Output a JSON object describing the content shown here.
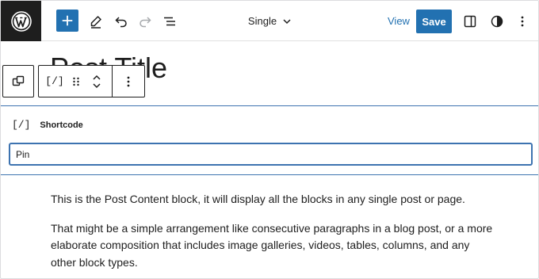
{
  "header": {
    "document_title": "Single",
    "view_label": "View",
    "save_label": "Save"
  },
  "post": {
    "title": "Post Title"
  },
  "block_toolbar": {
    "block_icon_text": "[/]"
  },
  "shortcode_block": {
    "icon_text": "[/]",
    "label": "Shortcode",
    "input_value": "Pin"
  },
  "content": {
    "paragraphs": [
      "This is the Post Content block, it will display all the blocks in any single post or page.",
      "That might be a simple arrangement like consecutive paragraphs in a blog post, or a more elaborate composition that includes image galleries, videos, tables, columns, and any other block types."
    ]
  },
  "colors": {
    "accent": "#2271b1",
    "logo_bg": "#1e1e1e",
    "selection_border": "#3d73b0"
  },
  "icons": {
    "logo": "wordpress-logo-icon",
    "inserter": "plus-icon",
    "tools": "pencil-icon",
    "undo": "undo-icon",
    "redo": "redo-icon",
    "list_view": "list-view-icon",
    "doc_title_dropdown": "chevron-down-icon",
    "settings": "sidebar-toggle-icon",
    "styles": "half-circle-icon",
    "options": "more-vertical-icon",
    "transform": "duplicate-icon",
    "drag": "drag-handle-icon",
    "move": "move-up-down-icon"
  }
}
